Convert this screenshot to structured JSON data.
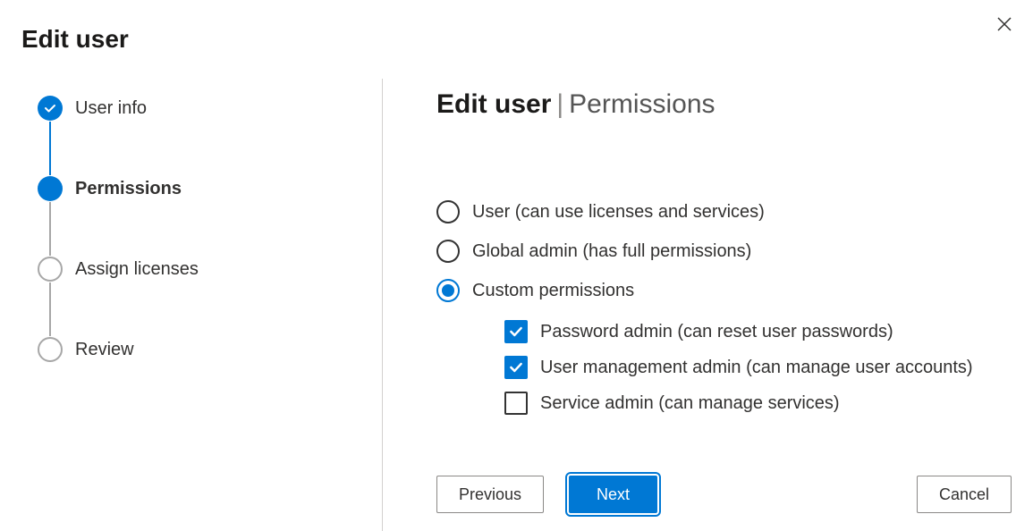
{
  "dialog": {
    "title": "Edit user",
    "close_aria": "Close"
  },
  "stepper": {
    "steps": [
      {
        "label": "User info",
        "state": "completed"
      },
      {
        "label": "Permissions",
        "state": "current"
      },
      {
        "label": "Assign licenses",
        "state": "pending"
      },
      {
        "label": "Review",
        "state": "pending"
      }
    ]
  },
  "panel": {
    "heading_bold": "Edit user",
    "heading_sep": "|",
    "heading_rest": "Permissions"
  },
  "permissions": {
    "radios": [
      {
        "id": "user",
        "label": "User (can use licenses and services)",
        "selected": false
      },
      {
        "id": "global",
        "label": "Global admin (has full permissions)",
        "selected": false
      },
      {
        "id": "custom",
        "label": "Custom permissions",
        "selected": true
      }
    ],
    "custom_checks": [
      {
        "id": "pwd",
        "label": "Password admin (can reset user passwords)",
        "checked": true
      },
      {
        "id": "um",
        "label": "User management admin (can manage user accounts)",
        "checked": true
      },
      {
        "id": "svc",
        "label": "Service admin (can manage services)",
        "checked": false
      }
    ]
  },
  "buttons": {
    "previous": "Previous",
    "next": "Next",
    "cancel": "Cancel"
  }
}
